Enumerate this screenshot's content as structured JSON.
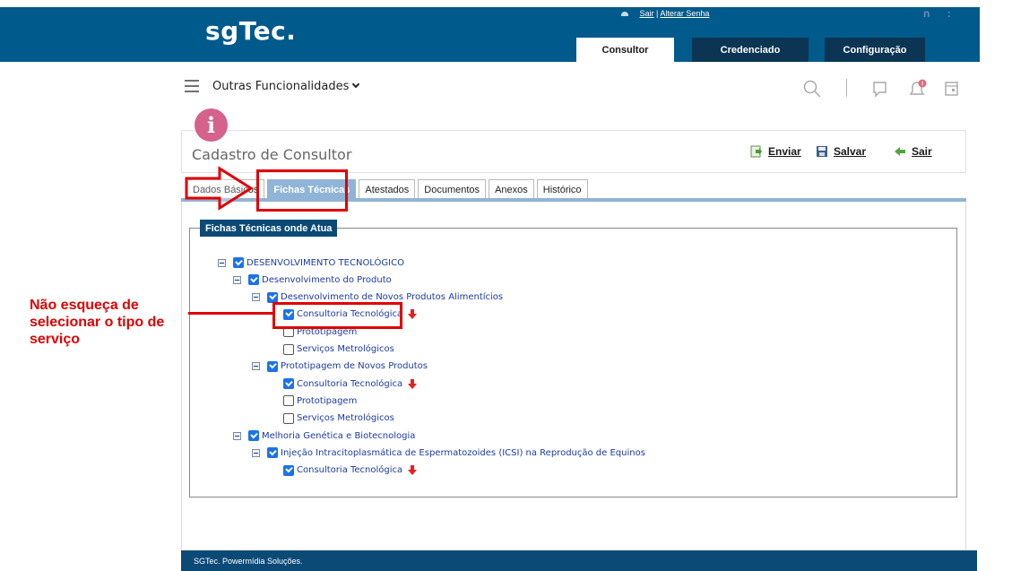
{
  "header": {
    "logo": "sgTec.",
    "link_sair": "Sair",
    "link_separator": "|",
    "link_alterar_senha": "Alterar Senha",
    "icons_text": "n :",
    "tabs": [
      {
        "label": "Consultor",
        "active": true
      },
      {
        "label": "Credenciado",
        "active": false
      },
      {
        "label": "Configuração",
        "active": false
      }
    ]
  },
  "toolbar": {
    "menu_label": "Outras Funcionalidades",
    "icons": [
      "menu-icon",
      "search-icon",
      "chat-icon",
      "bell-icon",
      "calendar-icon"
    ]
  },
  "form": {
    "title": "Cadastro de Consultor",
    "actions": [
      {
        "label": "Enviar",
        "icon": "send-icon"
      },
      {
        "label": "Salvar",
        "icon": "save-icon"
      },
      {
        "label": "Sair",
        "icon": "back-arrow-icon"
      }
    ],
    "tabs": [
      {
        "label": "Dados Básicos",
        "active": false
      },
      {
        "label": "Fichas Técnicas",
        "active": true
      },
      {
        "label": "Atestados",
        "active": false
      },
      {
        "label": "Documentos",
        "active": false
      },
      {
        "label": "Anexos",
        "active": false
      },
      {
        "label": "Histórico",
        "active": false
      }
    ]
  },
  "fichas": {
    "legend": "Fichas Técnicas onde Atua",
    "tree": [
      {
        "label": "DESENVOLVIMENTO TECNOLÓGICO",
        "level": 0,
        "expandable": true,
        "checked": true
      },
      {
        "label": "Desenvolvimento do Produto",
        "level": 1,
        "expandable": true,
        "checked": true
      },
      {
        "label": "Desenvolvimento de Novos Produtos Alimentícios",
        "level": 2,
        "expandable": true,
        "checked": true
      },
      {
        "label": "Consultoria Tecnológica",
        "level": 3,
        "expandable": false,
        "checked": true,
        "marked": true
      },
      {
        "label": "Prototipagem",
        "level": 3,
        "expandable": false,
        "checked": false
      },
      {
        "label": "Serviços Metrológicos",
        "level": 3,
        "expandable": false,
        "checked": false
      },
      {
        "label": "Prototipagem de Novos Produtos",
        "level": 2,
        "expandable": true,
        "checked": true
      },
      {
        "label": "Consultoria Tecnológica",
        "level": 3,
        "expandable": false,
        "checked": true,
        "marked": true
      },
      {
        "label": "Prototipagem",
        "level": 3,
        "expandable": false,
        "checked": false
      },
      {
        "label": "Serviços Metrológicos",
        "level": 3,
        "expandable": false,
        "checked": false
      },
      {
        "label": "Melhoria Genética e Biotecnologia",
        "level": 1,
        "expandable": true,
        "checked": true
      },
      {
        "label": "Injeção Intracitoplasmática de Espermatozoides (ICSI) na Reprodução de Equinos",
        "level": 2,
        "expandable": true,
        "checked": true
      },
      {
        "label": "Consultoria Tecnológica",
        "level": 3,
        "expandable": false,
        "checked": true,
        "marked": true
      }
    ]
  },
  "annotation": {
    "lines": [
      "Não esqueça de",
      "selecionar o tipo de",
      "serviço"
    ]
  },
  "footer": {
    "text": "SGTec. Powermídia Soluções."
  },
  "colors": {
    "header_blue": "#005a8c",
    "dark_navy": "#0b3553",
    "legend_blue": "#0b4a77",
    "active_tab": "#8fb4d6",
    "annotation_red": "#e00000",
    "info_pink": "#d4628a",
    "tree_text": "#1c3aa9"
  }
}
